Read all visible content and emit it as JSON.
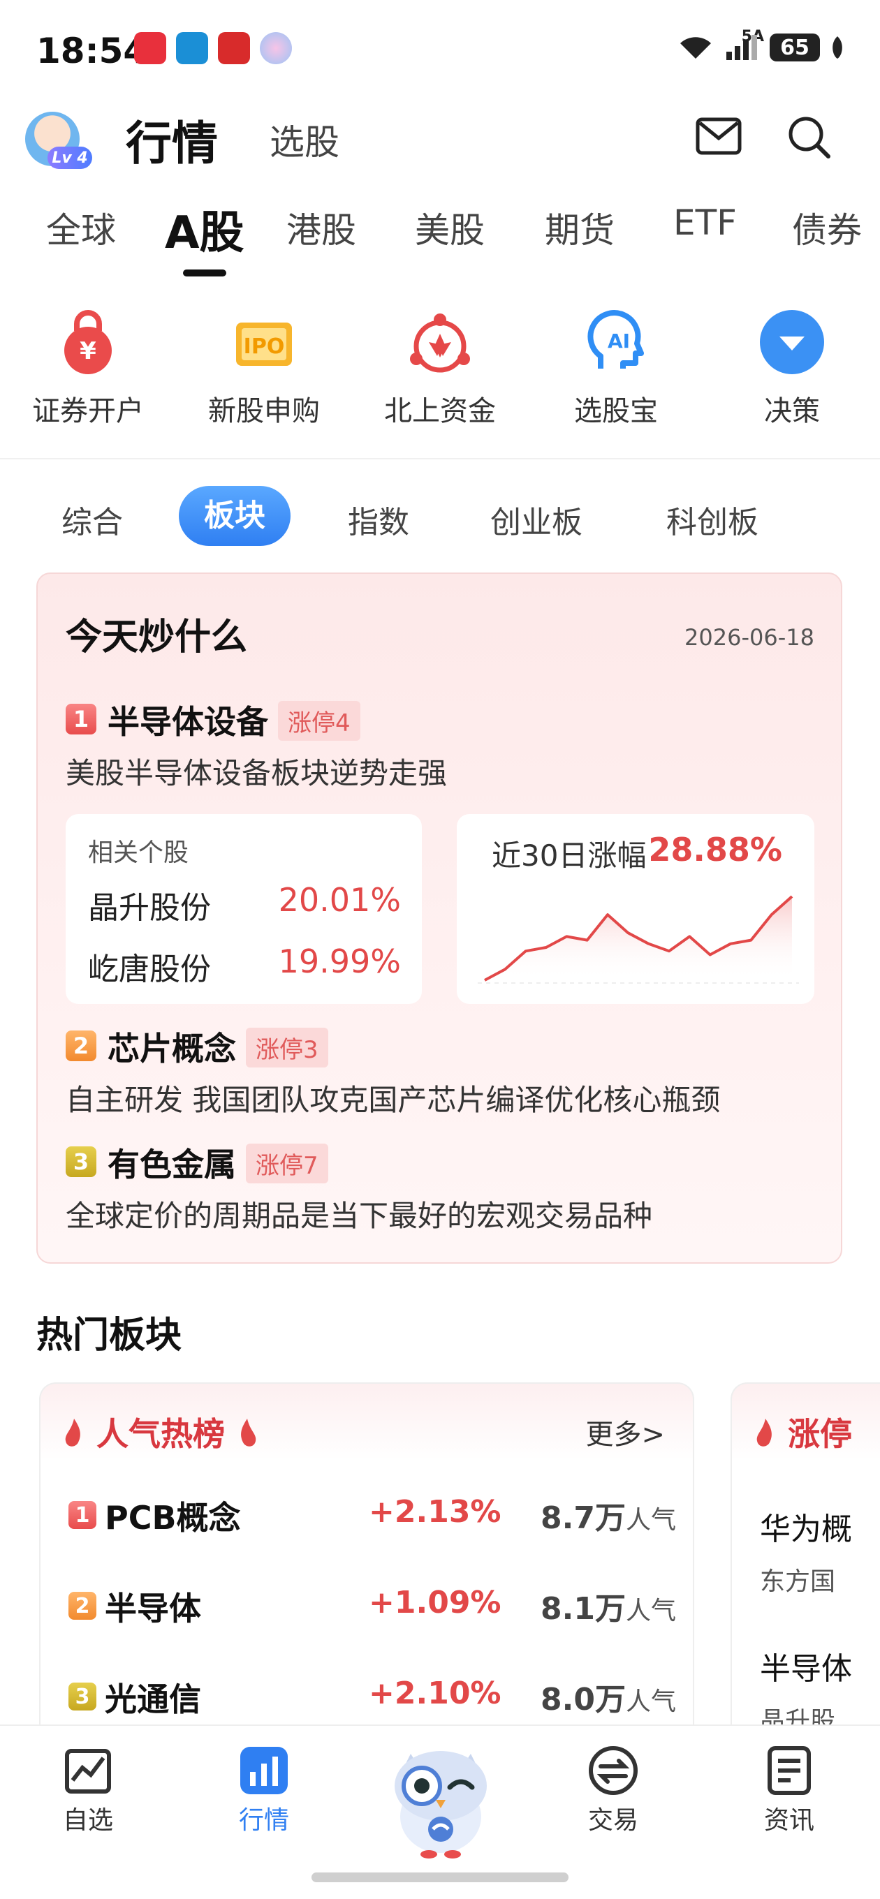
{
  "status_bar": {
    "time": "18:54",
    "network": "5A",
    "battery": "65"
  },
  "header": {
    "title": "行情",
    "subtitle": "选股",
    "level": "Lv 4"
  },
  "market_tabs": [
    "全球",
    "A股",
    "港股",
    "美股",
    "期货",
    "ETF",
    "债券"
  ],
  "shortcuts": [
    {
      "label": "证券开户",
      "icon": "lock-yen-icon"
    },
    {
      "label": "新股申购",
      "icon": "ipo-icon"
    },
    {
      "label": "北上资金",
      "icon": "bauhinia-icon"
    },
    {
      "label": "选股宝",
      "icon": "ai-head-icon"
    },
    {
      "label": "决策",
      "icon": "chevron-down-circle-icon"
    }
  ],
  "sub_tabs": [
    "综合",
    "板块",
    "指数",
    "创业板",
    "科创板"
  ],
  "today": {
    "title": "今天炒什么",
    "date": "2026-06-18",
    "topics": [
      {
        "rank": "1",
        "name": "半导体设备",
        "tag": "涨停4",
        "desc": "美股半导体设备板块逆势走强"
      },
      {
        "rank": "2",
        "name": "芯片概念",
        "tag": "涨停3",
        "desc": "自主研发 我国团队攻克国产芯片编译优化核心瓶颈"
      },
      {
        "rank": "3",
        "name": "有色金属",
        "tag": "涨停7",
        "desc": "全球定价的周期品是当下最好的宏观交易品种"
      }
    ],
    "related_label": "相关个股",
    "stocks": [
      {
        "name": "晶升股份",
        "pct": "20.01%"
      },
      {
        "name": "屹唐股份",
        "pct": "19.99%"
      }
    ],
    "chart_label": "近30日涨幅",
    "chart_pct": "28.88%"
  },
  "chart_data": {
    "type": "line",
    "title": "",
    "xlabel": "",
    "ylabel": "",
    "values": [
      0,
      3,
      8,
      9,
      12,
      11,
      18,
      13,
      10,
      8,
      12,
      7,
      10,
      11,
      18,
      23
    ]
  },
  "hot": {
    "title": "热门板块",
    "card_title": "人气热榜",
    "more": "更多>",
    "unit": "人气",
    "rows": [
      {
        "rank": "1",
        "name": "PCB概念",
        "chg": "+2.13%",
        "pop": "8.7万"
      },
      {
        "rank": "2",
        "name": "半导体",
        "chg": "+1.09%",
        "pop": "8.1万"
      },
      {
        "rank": "3",
        "name": "光通信",
        "chg": "+2.10%",
        "pop": "8.0万"
      }
    ],
    "side_title": "涨停",
    "side_lines": [
      "华为概",
      "东方国",
      "半导体",
      "晶升股"
    ]
  },
  "bottom_nav": [
    {
      "label": "自选",
      "icon": "chart-trend-icon"
    },
    {
      "label": "行情",
      "icon": "bar-chart-icon"
    },
    {
      "label": "",
      "icon": "owl-mascot-icon"
    },
    {
      "label": "交易",
      "icon": "exchange-icon"
    },
    {
      "label": "资讯",
      "icon": "news-icon"
    }
  ],
  "colors": {
    "accent": "#2f7ff2",
    "up": "#e24848",
    "card_bg": "#fdeaea"
  }
}
